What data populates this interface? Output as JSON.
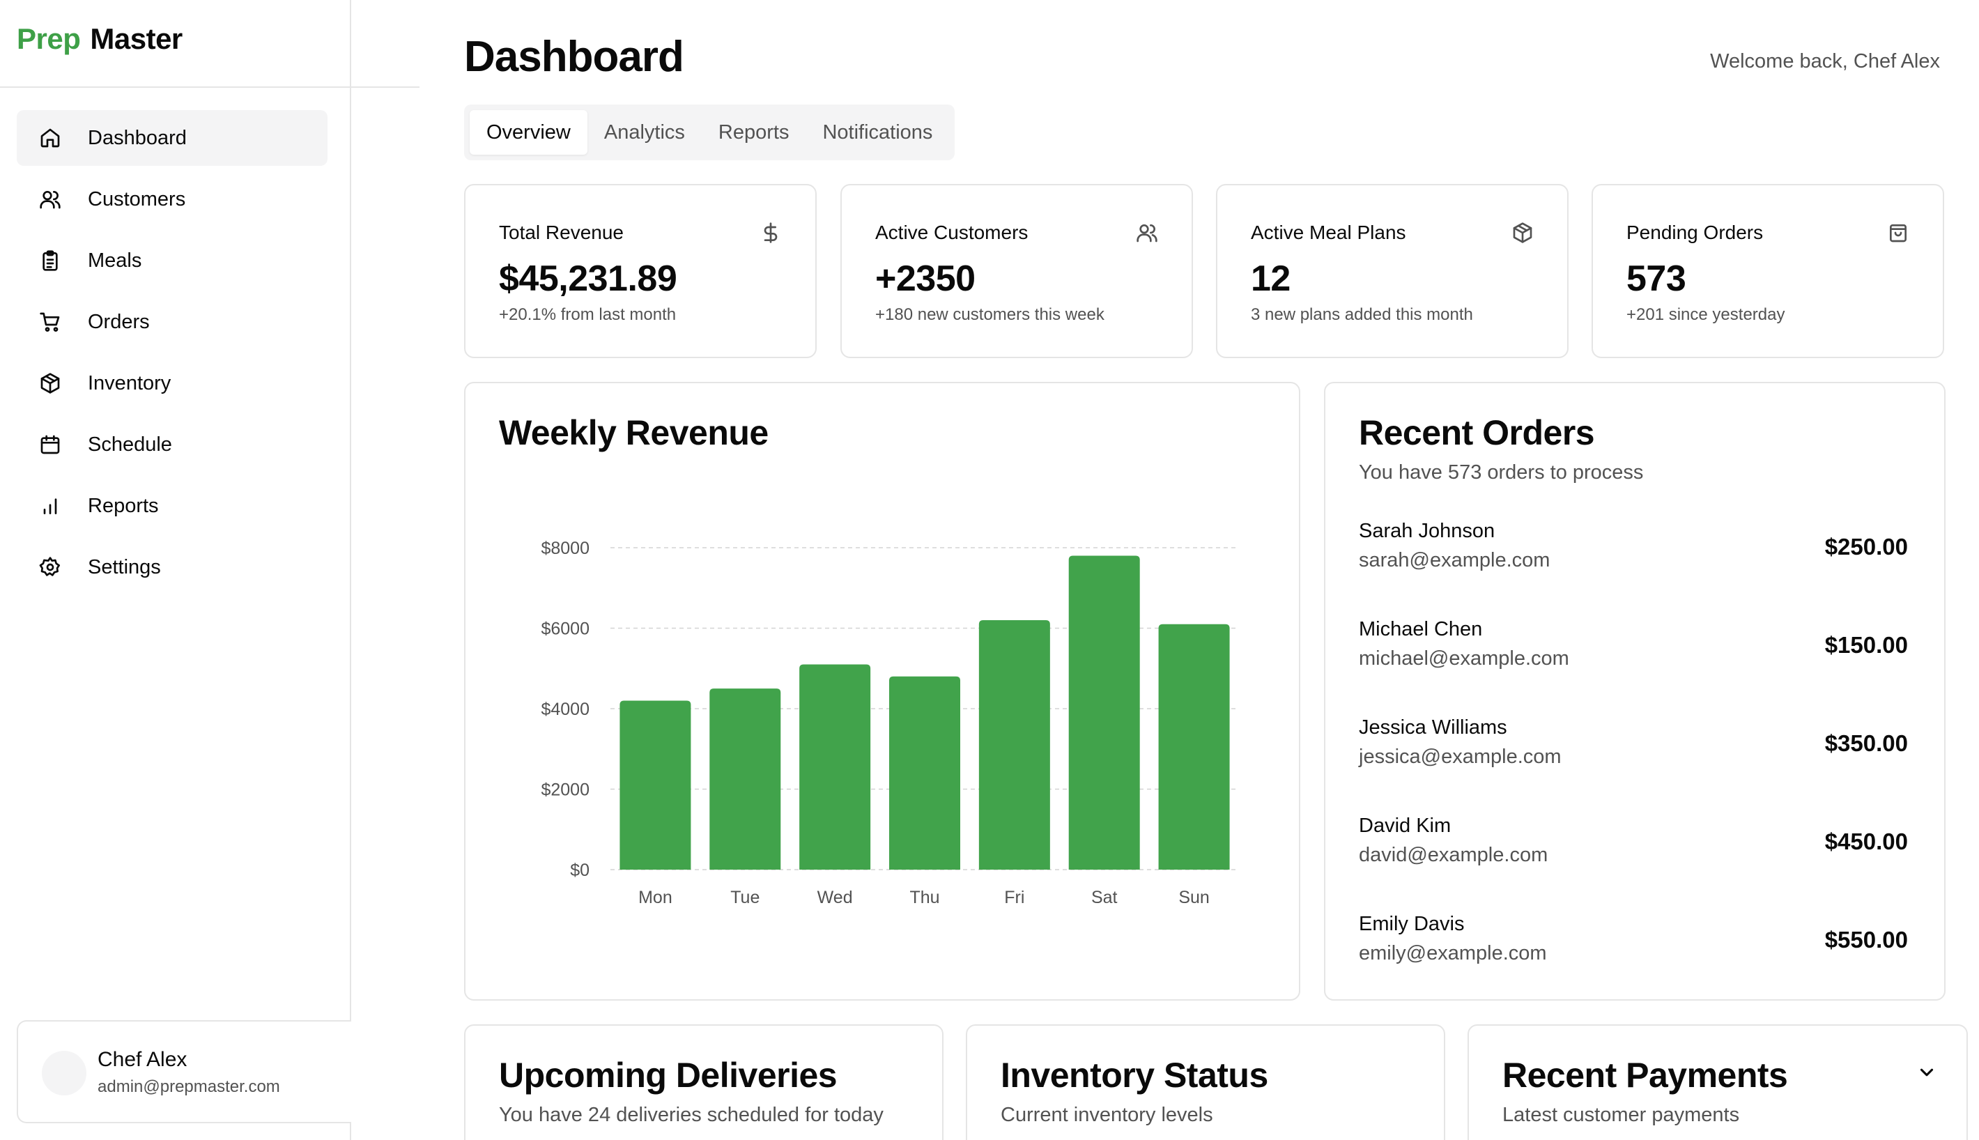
{
  "brand": {
    "prefix": "Prep",
    "name": "Master",
    "accent_color": "#3ea047"
  },
  "sidebar": {
    "items": [
      {
        "label": "Dashboard",
        "icon": "home-icon",
        "active": true
      },
      {
        "label": "Customers",
        "icon": "users-icon"
      },
      {
        "label": "Meals",
        "icon": "clipboard-icon"
      },
      {
        "label": "Orders",
        "icon": "cart-icon"
      },
      {
        "label": "Inventory",
        "icon": "package-icon"
      },
      {
        "label": "Schedule",
        "icon": "calendar-icon"
      },
      {
        "label": "Reports",
        "icon": "bar-chart-icon"
      },
      {
        "label": "Settings",
        "icon": "gear-icon"
      }
    ]
  },
  "user": {
    "name": "Chef Alex",
    "email": "admin@prepmaster.com"
  },
  "header": {
    "title": "Dashboard",
    "welcome": "Welcome back, Chef Alex"
  },
  "tabs": [
    {
      "label": "Overview",
      "active": true
    },
    {
      "label": "Analytics"
    },
    {
      "label": "Reports"
    },
    {
      "label": "Notifications"
    }
  ],
  "stats": [
    {
      "title": "Total Revenue",
      "value": "$45,231.89",
      "sub": "+20.1% from last month",
      "icon": "dollar-icon"
    },
    {
      "title": "Active Customers",
      "value": "+2350",
      "sub": "+180 new customers this week",
      "icon": "users-icon"
    },
    {
      "title": "Active Meal Plans",
      "value": "12",
      "sub": "3 new plans added this month",
      "icon": "package-icon"
    },
    {
      "title": "Pending Orders",
      "value": "573",
      "sub": "+201 since yesterday",
      "icon": "shopping-bag-icon"
    }
  ],
  "weekly_revenue": {
    "title": "Weekly Revenue"
  },
  "chart_data": {
    "type": "bar",
    "title": "Weekly Revenue",
    "categories": [
      "Mon",
      "Tue",
      "Wed",
      "Thu",
      "Fri",
      "Sat",
      "Sun"
    ],
    "values": [
      4200,
      4500,
      5100,
      4800,
      6200,
      7800,
      6100
    ],
    "ylim": [
      0,
      8000
    ],
    "yticks": [
      0,
      2000,
      4000,
      6000,
      8000
    ],
    "ytick_labels": [
      "$0",
      "$2000",
      "$4000",
      "$6000",
      "$8000"
    ],
    "grid": true,
    "bar_color": "#41a34b"
  },
  "recent_orders": {
    "title": "Recent Orders",
    "subtitle": "You have 573 orders to process",
    "items": [
      {
        "name": "Sarah Johnson",
        "email": "sarah@example.com",
        "amount": "$250.00"
      },
      {
        "name": "Michael Chen",
        "email": "michael@example.com",
        "amount": "$150.00"
      },
      {
        "name": "Jessica Williams",
        "email": "jessica@example.com",
        "amount": "$350.00"
      },
      {
        "name": "David Kim",
        "email": "david@example.com",
        "amount": "$450.00"
      },
      {
        "name": "Emily Davis",
        "email": "emily@example.com",
        "amount": "$550.00"
      }
    ]
  },
  "bottom_cards": [
    {
      "title": "Upcoming Deliveries",
      "subtitle": "You have 24 deliveries scheduled for today"
    },
    {
      "title": "Inventory Status",
      "subtitle": "Current inventory levels"
    },
    {
      "title": "Recent Payments",
      "subtitle": "Latest customer payments",
      "icon": "chevron-down-icon"
    }
  ]
}
